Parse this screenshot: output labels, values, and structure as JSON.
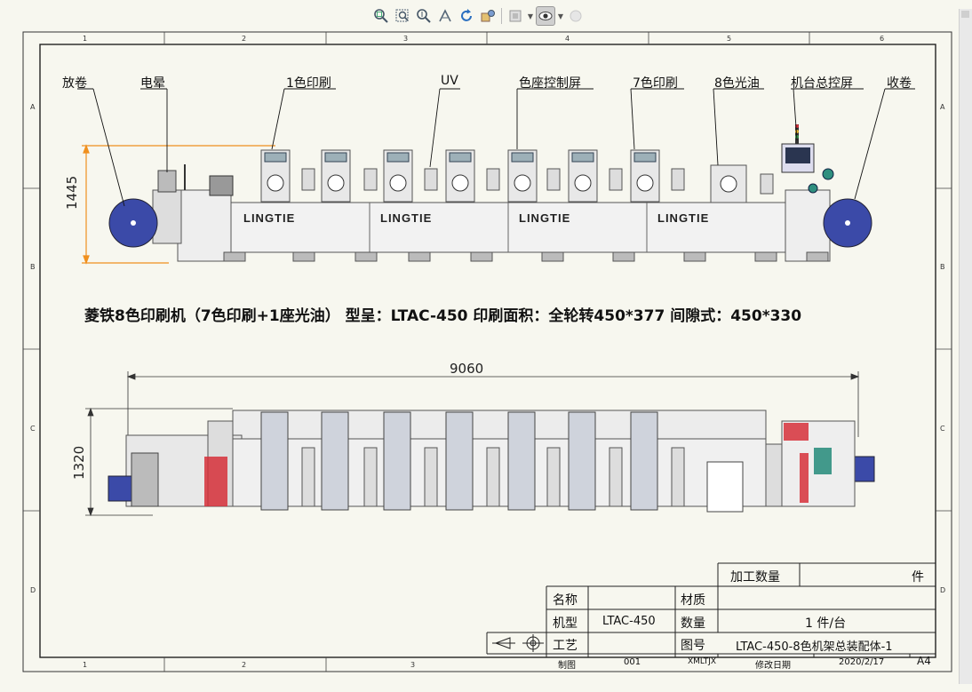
{
  "toolbar": {
    "buttons": [
      {
        "name": "zoom-fit-icon",
        "glyph": "⌕"
      },
      {
        "name": "zoom-area-icon",
        "glyph": "⊡"
      },
      {
        "name": "zoom-in-out-icon",
        "glyph": "⌕"
      },
      {
        "name": "pan-icon",
        "glyph": "✥"
      },
      {
        "name": "rotate-icon",
        "glyph": "↻"
      },
      {
        "name": "view-orientation-icon",
        "glyph": "⚙"
      },
      {
        "name": "display-style-icon",
        "glyph": "▢"
      },
      {
        "name": "hide-show-icon",
        "glyph": "◉"
      },
      {
        "name": "appearance-icon",
        "glyph": "●"
      }
    ]
  },
  "grid": {
    "top_numbers": [
      "1",
      "2",
      "3",
      "4",
      "5",
      "6"
    ],
    "bottom_numbers": [
      "1",
      "2",
      "3"
    ],
    "side_letters": [
      "A",
      "B",
      "C",
      "D"
    ]
  },
  "callouts": {
    "unwind": "放卷",
    "corona": "电晕",
    "print1": "1色印刷",
    "uv": "UV",
    "register_screen": "色座控制屏",
    "print7": "7色印刷",
    "varnish": "8色光油",
    "main_console": "机台总控屏",
    "rewind": "收卷"
  },
  "brand_labels": [
    "LINGTIE",
    "LINGTIE",
    "LINGTIE",
    "LINGTIE"
  ],
  "dimensions": {
    "front_height": "1445",
    "top_length": "9060",
    "top_width": "1320"
  },
  "title_line": "菱铁8色印刷机（7色印刷+1座光油）  型呈：LTAC-450  印刷面积：全轮转450*377 间隙式：450*330",
  "title_block": {
    "qty_label": "加工数量",
    "qty_unit": "件",
    "name_label": "名称",
    "name_value": "",
    "material_label": "材质",
    "material_value": "",
    "model_label": "机型",
    "model_value": "LTAC-450",
    "count_label": "数量",
    "count_value": "1  件/台",
    "process_label": "工艺",
    "drawing_no_label": "图号",
    "drawing_no_value": "LTAC-450-8色机架总装配体-1",
    "drawn_label": "制图",
    "drawn_value": "001",
    "company": "XMLTJX",
    "revision_date_label": "修改日期",
    "date_value": "2020/2/17",
    "sheet_size": "A4"
  },
  "colors": {
    "roll_blue": "#3b4aa8",
    "dimension_orange": "#f0901e",
    "console_teal": "#2f8f7f",
    "red_part": "#d6303a",
    "sheet_bg": "#f7f7ef"
  }
}
